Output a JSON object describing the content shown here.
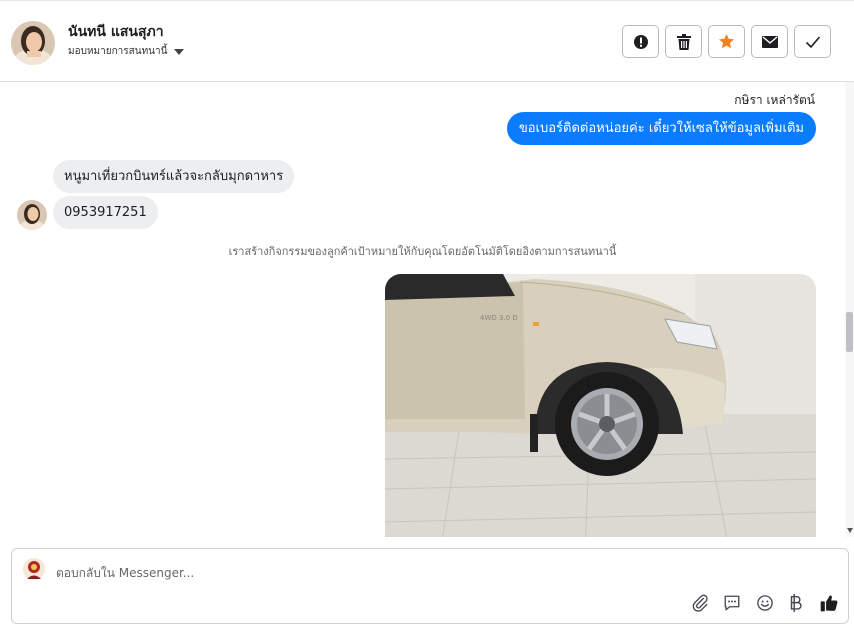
{
  "header": {
    "contact_name": "นันทนี แสนสุภา",
    "assign_label": "มอบหมายการสนทนานี้",
    "actions": [
      {
        "name": "mark-spam-button",
        "icon": "exclamation-circle-icon"
      },
      {
        "name": "delete-button",
        "icon": "trash-icon"
      },
      {
        "name": "star-button",
        "icon": "star-icon",
        "color": "#f5821f"
      },
      {
        "name": "mark-unread-button",
        "icon": "envelope-icon"
      },
      {
        "name": "mark-done-button",
        "icon": "checkmark-icon"
      }
    ]
  },
  "thread": {
    "outgoing_sender": "กษิรา เหล่ารัตน์",
    "outgoing_message": "ขอเบอร์ติดต่อหน่อยค่ะ เดี๋ยวให้เซลให้ข้อมูลเพิ่มเติม",
    "incoming_messages": [
      "หนูมาเที่ยวกบินทร์แล้วจะกลับมุกดาหาร",
      "0953917251"
    ],
    "system_note": "เราสร้างกิจกรรมของลูกค้าเป้าหมายให้กับคุณโดยอัตโนมัติโดยอิงตามการสนทนานี้",
    "photo_badge_text": "4WD 3.0 D"
  },
  "composer": {
    "placeholder": "ตอบกลับใน Messenger...",
    "tools": [
      "attach-icon",
      "saved-replies-icon",
      "emoji-icon",
      "baht-icon",
      "like-icon"
    ]
  },
  "colors": {
    "accent": "#0a7cff",
    "incoming_bubble": "#eceef0",
    "star": "#f5821f"
  }
}
